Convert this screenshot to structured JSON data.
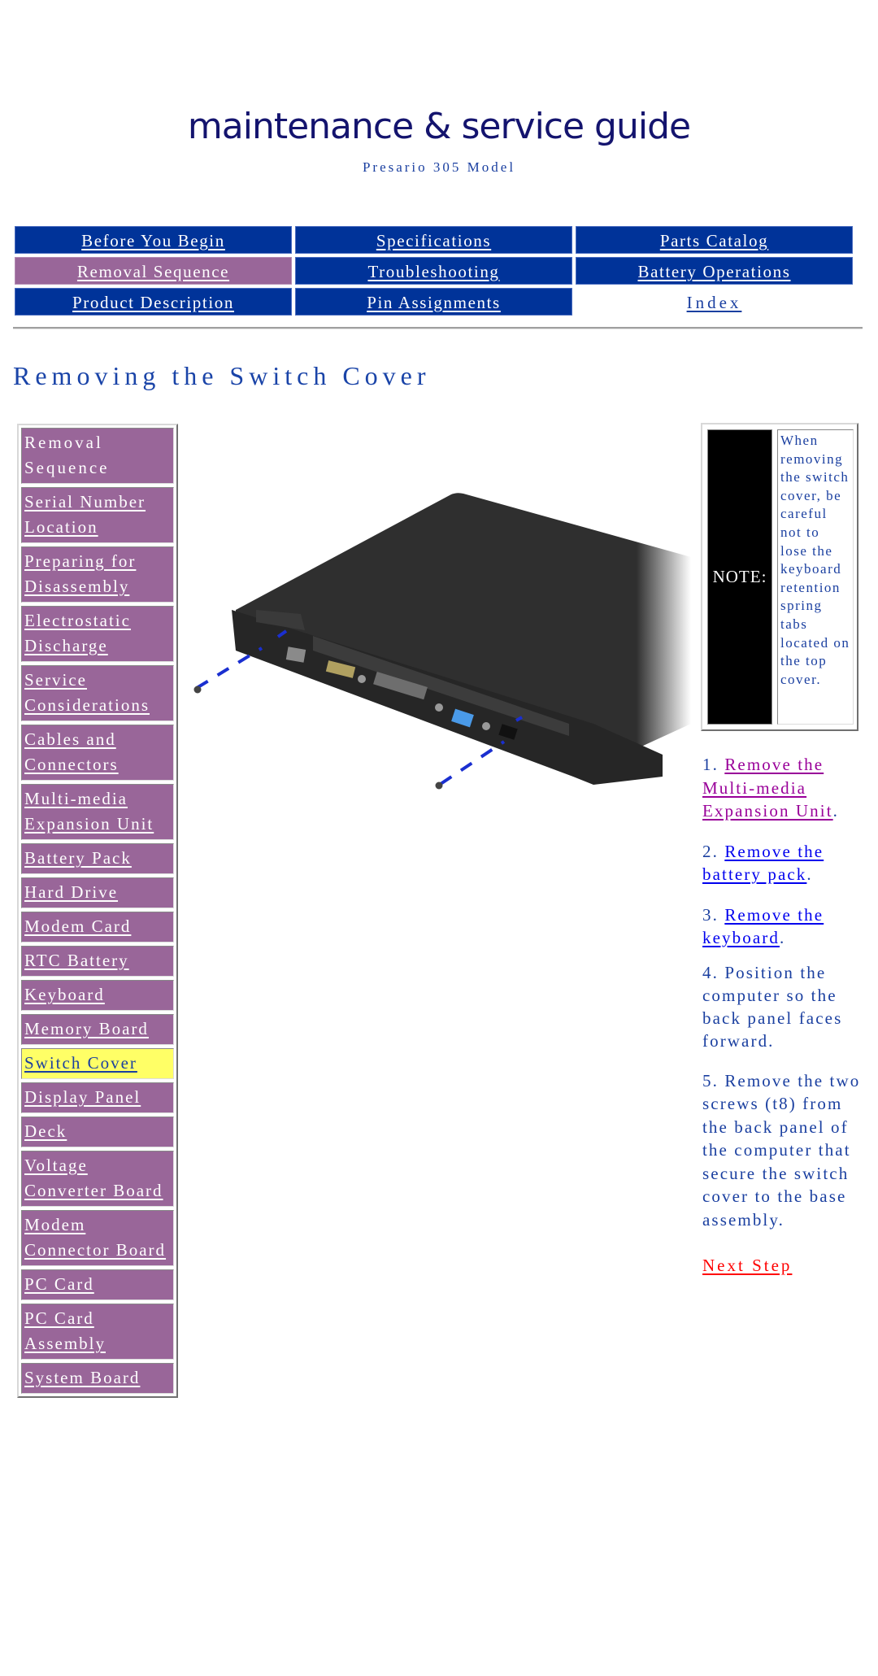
{
  "header": {
    "logo_text": "maintenance & service guide",
    "subtitle": "Presario 305 Model"
  },
  "nav": {
    "items": [
      {
        "label": "Before You Begin",
        "state": "normal"
      },
      {
        "label": "Specifications",
        "state": "normal"
      },
      {
        "label": "Parts Catalog",
        "state": "normal"
      },
      {
        "label": "Removal Sequence",
        "state": "active"
      },
      {
        "label": "Troubleshooting",
        "state": "normal"
      },
      {
        "label": "Battery Operations",
        "state": "normal"
      },
      {
        "label": "Product Description",
        "state": "normal"
      },
      {
        "label": "Pin Assignments",
        "state": "normal"
      },
      {
        "label": "Index",
        "state": "plain"
      }
    ]
  },
  "page": {
    "title": "Removing the Switch Cover"
  },
  "sidebar": {
    "heading": "Removal Sequence",
    "items": [
      {
        "label": "Serial Number Location"
      },
      {
        "label": "Preparing for Disassembly"
      },
      {
        "label": "Electrostatic Discharge"
      },
      {
        "label": "Service Considerations"
      },
      {
        "label": "Cables and Connectors"
      },
      {
        "label": "Multi-media Expansion Unit"
      },
      {
        "label": "Battery Pack"
      },
      {
        "label": "Hard Drive"
      },
      {
        "label": "Modem Card"
      },
      {
        "label": "RTC Battery"
      },
      {
        "label": "Keyboard"
      },
      {
        "label": "Memory Board"
      },
      {
        "label": "Switch Cover",
        "current": true
      },
      {
        "label": "Display Panel"
      },
      {
        "label": "Deck"
      },
      {
        "label": "Voltage Converter Board"
      },
      {
        "label": "Modem Connector Board"
      },
      {
        "label": "PC Card"
      },
      {
        "label": "PC Card Assembly"
      },
      {
        "label": "System Board"
      }
    ]
  },
  "illustration": {
    "description": "Back panel of notebook computer with two screws removed from switch cover"
  },
  "note": {
    "label": "NOTE:",
    "text": "When removing the switch cover, be careful not to lose the keyboard retention spring tabs located on the top cover."
  },
  "steps": [
    {
      "number": "1.",
      "link_text": "Remove the Multi-media Expansion Unit",
      "suffix": ".",
      "link_state": "visited"
    },
    {
      "number": "2.",
      "link_text": "Remove the battery pack",
      "suffix": ".",
      "link_state": "link"
    },
    {
      "number": "3.",
      "link_text": "Remove the keyboard",
      "suffix": ".",
      "link_state": "link"
    },
    {
      "number": "4.",
      "text": "Position the computer so the back panel faces forward."
    },
    {
      "number": "5.",
      "text": "Remove the two screws (t8) from the back panel of the computer that secure the switch cover to the base assembly."
    }
  ],
  "next_step": {
    "label": "Next Step"
  },
  "colors": {
    "nav_blue": "#003399",
    "active_purple": "#996699",
    "current_highlight": "#ffff66",
    "text_blue": "#1a3fa0",
    "visited_link": "#990099",
    "unvisited_link": "#0000ee",
    "next_step_red": "#ff0000",
    "screw_marker_blue": "#1a2fd0"
  }
}
